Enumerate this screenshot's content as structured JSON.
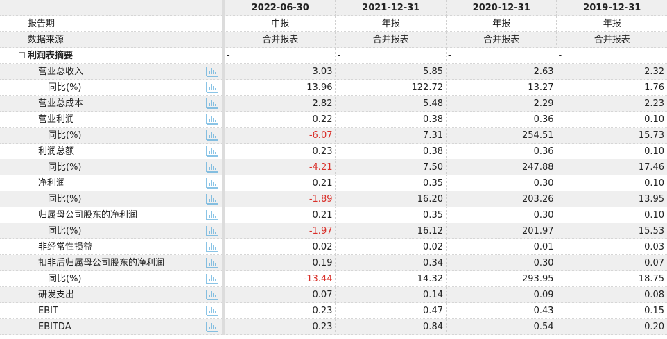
{
  "header": {
    "dates": [
      "2022-06-30",
      "2021-12-31",
      "2020-12-31",
      "2019-12-31"
    ],
    "report_period_label": "报告期",
    "report_periods": [
      "中报",
      "年报",
      "年报",
      "年报"
    ],
    "data_source_label": "数据来源",
    "data_sources": [
      "合并报表",
      "合并报表",
      "合并报表",
      "合并报表"
    ]
  },
  "section": {
    "title": "利润表摘要",
    "values": [
      "-",
      "-",
      "-",
      "-"
    ]
  },
  "rows": [
    {
      "label": "营业总收入",
      "level": 1,
      "values": [
        "3.03",
        "5.85",
        "2.63",
        "2.32"
      ]
    },
    {
      "label": "同比(%)",
      "level": 2,
      "values": [
        "13.96",
        "122.72",
        "13.27",
        "1.76"
      ]
    },
    {
      "label": "营业总成本",
      "level": 1,
      "values": [
        "2.82",
        "5.48",
        "2.29",
        "2.23"
      ]
    },
    {
      "label": "营业利润",
      "level": 1,
      "values": [
        "0.22",
        "0.38",
        "0.36",
        "0.10"
      ]
    },
    {
      "label": "同比(%)",
      "level": 2,
      "values": [
        "-6.07",
        "7.31",
        "254.51",
        "15.73"
      ]
    },
    {
      "label": "利润总额",
      "level": 1,
      "values": [
        "0.23",
        "0.38",
        "0.36",
        "0.10"
      ]
    },
    {
      "label": "同比(%)",
      "level": 2,
      "values": [
        "-4.21",
        "7.50",
        "247.88",
        "17.46"
      ]
    },
    {
      "label": "净利润",
      "level": 1,
      "values": [
        "0.21",
        "0.35",
        "0.30",
        "0.10"
      ]
    },
    {
      "label": "同比(%)",
      "level": 2,
      "values": [
        "-1.89",
        "16.20",
        "203.26",
        "13.95"
      ]
    },
    {
      "label": "归属母公司股东的净利润",
      "level": 1,
      "values": [
        "0.21",
        "0.35",
        "0.30",
        "0.10"
      ]
    },
    {
      "label": "同比(%)",
      "level": 2,
      "values": [
        "-1.97",
        "16.12",
        "201.97",
        "15.53"
      ]
    },
    {
      "label": "非经常性损益",
      "level": 1,
      "values": [
        "0.02",
        "0.02",
        "0.01",
        "0.03"
      ]
    },
    {
      "label": "扣非后归属母公司股东的净利润",
      "level": 1,
      "values": [
        "0.19",
        "0.34",
        "0.30",
        "0.07"
      ]
    },
    {
      "label": "同比(%)",
      "level": 2,
      "values": [
        "-13.44",
        "14.32",
        "293.95",
        "18.75"
      ]
    },
    {
      "label": "研发支出",
      "level": 1,
      "values": [
        "0.07",
        "0.14",
        "0.09",
        "0.08"
      ]
    },
    {
      "label": "EBIT",
      "level": 1,
      "values": [
        "0.23",
        "0.47",
        "0.43",
        "0.15"
      ]
    },
    {
      "label": "EBITDA",
      "level": 1,
      "values": [
        "0.23",
        "0.84",
        "0.54",
        "0.20"
      ]
    }
  ],
  "colors": {
    "negative": "#d9302a",
    "chart_icon": "#4aa3d8",
    "row_alt_bg": "#efefef"
  },
  "icons": {
    "row_chart": "bar-chart-icon",
    "section_toggle": "collapse-minus-icon"
  }
}
